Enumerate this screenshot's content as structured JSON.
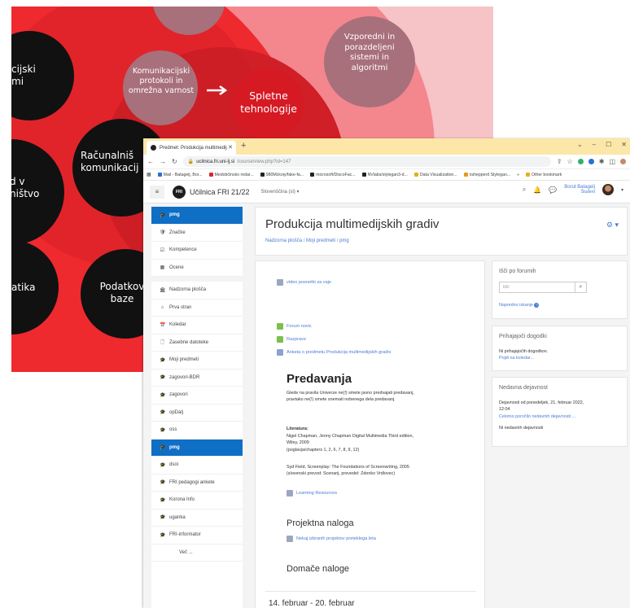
{
  "poster": {
    "colors": {
      "bg": "#f0a7ad",
      "red": "#ee2a2f",
      "dark_red": "#c81b22",
      "mauve": "#a8707a",
      "black": "#111111"
    },
    "bubbles": {
      "kijski": "cijski\nmi",
      "d_v": "d v\nništvo",
      "atika": "atika",
      "komun_protokoli": "Komunikacijski\nprotokoli in\nomrežna varnost",
      "spletne": "Spletne\ntehnologije",
      "vzporedni": "Vzporedni in\nporazdeljeni\nsistemi in\nalgoritmi",
      "racunalniske": "Računalniš\nkomunikacij",
      "podatkovne": "Podatkov\nbaze"
    }
  },
  "browser": {
    "tab_title": "Predmet: Produkcija multimedij",
    "url_host": "ucilnica.fri.uni-lj.si",
    "url_path": "/course/view.php?id=147",
    "bookmarks": [
      {
        "label": "Mail - Batagelj, Bor...",
        "color": "#2a6fd6"
      },
      {
        "label": "Medobčinsko redar...",
        "color": "#d62a2a"
      },
      {
        "label": "980Mckoiy/fake-fa...",
        "color": "#222222"
      },
      {
        "label": "microsoft/DiscoFac...",
        "color": "#222222"
      },
      {
        "label": "NVlabs/stylegan3-d...",
        "color": "#222222"
      },
      {
        "label": "Data Visualization...",
        "color": "#e3b21d"
      },
      {
        "label": "nshepperd Stylegan...",
        "color": "#e39a1d"
      }
    ],
    "other_bookmarks": "Other bookmark"
  },
  "moodle": {
    "site_name": "Učilnica FRI 21/22",
    "language": "Slovenščina (sl) ▾",
    "user_name": "Borut Batagelj",
    "user_role": "Študent",
    "nav": [
      {
        "label": "pmg",
        "icon": "graduation-cap",
        "glyph": "🎓",
        "active": true
      },
      {
        "label": "Značke",
        "icon": "shield",
        "glyph": "🛡",
        "active": false
      },
      {
        "label": "Kompetence",
        "icon": "checkbox",
        "glyph": "☑",
        "active": false
      },
      {
        "label": "Ocene",
        "icon": "grid",
        "glyph": "▦",
        "active": false
      },
      {
        "gap": true
      },
      {
        "label": "Nadzorna plošča",
        "icon": "dashboard",
        "glyph": "🏛",
        "active": false
      },
      {
        "label": "Prva stran",
        "icon": "home",
        "glyph": "⌂",
        "active": false
      },
      {
        "label": "Koledar",
        "icon": "calendar",
        "glyph": "📅",
        "active": false
      },
      {
        "label": "Zasebne datoteke",
        "icon": "file",
        "glyph": "🗋",
        "active": false
      },
      {
        "label": "Moji predmeti",
        "icon": "graduation-cap",
        "glyph": "🎓",
        "active": false
      },
      {
        "label": "zagovori-BDR",
        "icon": "graduation-cap",
        "glyph": "🎓",
        "active": false
      },
      {
        "label": "zagovori",
        "icon": "graduation-cap",
        "glyph": "🎓",
        "active": false
      },
      {
        "label": "opDalj",
        "icon": "graduation-cap",
        "glyph": "🎓",
        "active": false
      },
      {
        "label": "oss",
        "icon": "graduation-cap",
        "glyph": "🎓",
        "active": false
      },
      {
        "label": "pmg",
        "icon": "graduation-cap",
        "glyph": "🎓",
        "active": true
      },
      {
        "label": "dsoi",
        "icon": "graduation-cap",
        "glyph": "🎓",
        "active": false
      },
      {
        "label": "FRI pedagogi ankete",
        "icon": "graduation-cap",
        "glyph": "🎓",
        "active": false
      },
      {
        "label": "Korona Info",
        "icon": "graduation-cap",
        "glyph": "🎓",
        "active": false
      },
      {
        "label": "uganka",
        "icon": "graduation-cap",
        "glyph": "🎓",
        "active": false
      },
      {
        "label": "FRI-informator",
        "icon": "graduation-cap",
        "glyph": "🎓",
        "active": false
      },
      {
        "label": "Več ...",
        "icon": "",
        "glyph": "",
        "active": false
      }
    ],
    "page_title": "Produkcija multimedijskih gradiv",
    "breadcrumb": [
      "Nadzorna plošča",
      "Moji predmeti",
      "pmg"
    ],
    "course": {
      "video_link": "video posnetki za vaje",
      "forum_novic": "Forum novic",
      "razprave": "Razprave",
      "anketa": "Anketa o predmetu Produkcija multimedijskih gradiv",
      "predavanja_title": "Predavanja",
      "predavanja_text": "Glede na pravila Univerze ne(!) smete javno predvajati predavanj,\npravtako ne(!) smete snemati nobenega dela predavanj.",
      "literatura_label": "Literatura:",
      "literatura_1": "Nigel Chapman, Jenny Chapman Digital Multimedia Third edition,\nWiley, 2009\n(poglavja/chapters 1, 2, 6, 7, 8, 9, 12)",
      "literatura_2": "Syd Field, Screenplay: The Foundations of Screenwriting, 2005\n(slovenski prevod: Scenarij, prevedel: Zdenko Vrdlovec)",
      "learning_resources": "Learning Resources",
      "projektna_title": "Projektna naloga",
      "projekti_link": "Nekaj izbranih projektov preteklega leta",
      "domace_title": "Domače naloge",
      "week_title": "14. februar - 20. februar"
    },
    "blocks": {
      "search_title": "Išči po forumih",
      "search_placeholder": "Išči",
      "advanced_search": "Napredno iskanje",
      "events_title": "Prihajajoči dogodki",
      "no_events": "Ni prihajajočih dogodkov.",
      "goto_calendar": "Pojdi na koledar...",
      "recent_title": "Nedavna dejavnost",
      "recent_since": "Dejavnosti od ponedeljek, 21. februar 2022,\n12:04",
      "full_report": "Celotno poročilo nedavnih dejavnosti ...",
      "no_recent": "Ni nedavnih dejavnosti"
    }
  }
}
